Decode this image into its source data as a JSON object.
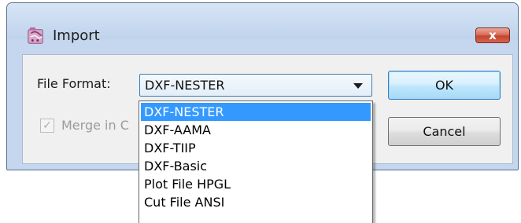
{
  "window": {
    "title": "Import",
    "close_glyph": "x"
  },
  "form": {
    "file_format_label": "File Format:",
    "file_format_value": "DXF-NESTER",
    "merge_label": "Merge in C",
    "merge_checked": true,
    "merge_enabled": false
  },
  "buttons": {
    "ok_label": "OK",
    "cancel_label": "Cancel"
  },
  "dropdown": {
    "open": true,
    "selected_index": 0,
    "options": [
      "DXF-NESTER",
      "DXF-AAMA",
      "DXF-TIIP",
      "DXF-Basic",
      "Plot File HPGL",
      "Cut File ANSI"
    ]
  },
  "colors": {
    "selection": "#3399ff",
    "window_frame": "#c4d7ee",
    "close_button": "#c3452f"
  }
}
